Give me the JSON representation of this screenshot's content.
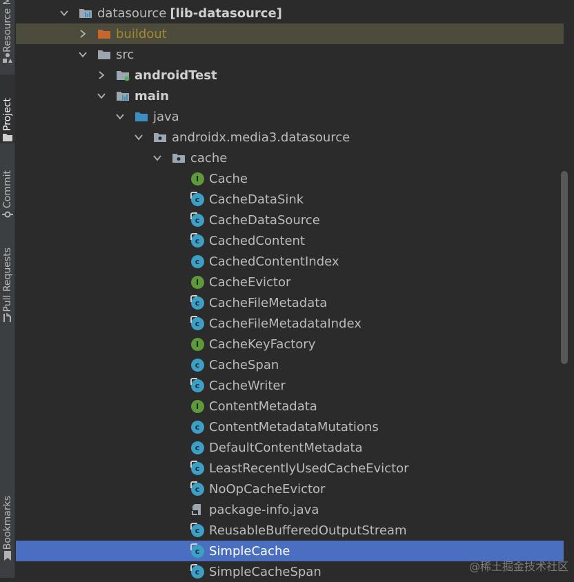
{
  "toolwindows": [
    {
      "label": "Resource Manager",
      "icon": "shapes-icon"
    },
    {
      "label": "Project",
      "icon": "folder-icon",
      "active": true
    },
    {
      "label": "Commit",
      "icon": "commit-icon"
    },
    {
      "label": "Pull Requests",
      "icon": "pull-request-icon"
    },
    {
      "label": "Bookmarks",
      "icon": "bookmark-icon"
    }
  ],
  "tree": [
    {
      "label": "datasource",
      "qualifier": "[lib-datasource]",
      "depth": 0,
      "arrow": "down",
      "icon": "module-folder-icon"
    },
    {
      "label": "buildout",
      "depth": 1,
      "arrow": "right",
      "icon": "excluded-folder-icon",
      "style": "orange",
      "highlight": true
    },
    {
      "label": "src",
      "depth": 1,
      "arrow": "down",
      "icon": "folder-icon"
    },
    {
      "label": "androidTest",
      "depth": 2,
      "arrow": "right",
      "icon": "test-folder-icon",
      "bold": true
    },
    {
      "label": "main",
      "depth": 2,
      "arrow": "down",
      "icon": "module-folder-icon",
      "bold": true
    },
    {
      "label": "java",
      "depth": 3,
      "arrow": "down",
      "icon": "source-folder-icon"
    },
    {
      "label": "androidx.media3.datasource",
      "depth": 4,
      "arrow": "down",
      "icon": "package-icon"
    },
    {
      "label": "cache",
      "depth": 5,
      "arrow": "down",
      "icon": "package-icon"
    },
    {
      "label": "Cache",
      "depth": 6,
      "icon": "interface-icon"
    },
    {
      "label": "CacheDataSink",
      "depth": 6,
      "icon": "class-icon",
      "pinned": true
    },
    {
      "label": "CacheDataSource",
      "depth": 6,
      "icon": "class-icon",
      "pinned": true
    },
    {
      "label": "CachedContent",
      "depth": 6,
      "icon": "class-icon",
      "pinned": true
    },
    {
      "label": "CachedContentIndex",
      "depth": 6,
      "icon": "class-icon"
    },
    {
      "label": "CacheEvictor",
      "depth": 6,
      "icon": "interface-icon"
    },
    {
      "label": "CacheFileMetadata",
      "depth": 6,
      "icon": "class-icon",
      "pinned": true
    },
    {
      "label": "CacheFileMetadataIndex",
      "depth": 6,
      "icon": "class-icon",
      "pinned": true
    },
    {
      "label": "CacheKeyFactory",
      "depth": 6,
      "icon": "interface-icon"
    },
    {
      "label": "CacheSpan",
      "depth": 6,
      "icon": "class-icon"
    },
    {
      "label": "CacheWriter",
      "depth": 6,
      "icon": "class-icon",
      "pinned": true
    },
    {
      "label": "ContentMetadata",
      "depth": 6,
      "icon": "interface-icon"
    },
    {
      "label": "ContentMetadataMutations",
      "depth": 6,
      "icon": "class-icon"
    },
    {
      "label": "DefaultContentMetadata",
      "depth": 6,
      "icon": "class-icon"
    },
    {
      "label": "LeastRecentlyUsedCacheEvictor",
      "depth": 6,
      "icon": "class-icon",
      "pinned": true
    },
    {
      "label": "NoOpCacheEvictor",
      "depth": 6,
      "icon": "class-icon",
      "pinned": true
    },
    {
      "label": "package-info.java",
      "depth": 6,
      "icon": "java-file-icon"
    },
    {
      "label": "ReusableBufferedOutputStream",
      "depth": 6,
      "icon": "class-icon",
      "pinned": true
    },
    {
      "label": "SimpleCache",
      "depth": 6,
      "icon": "class-icon",
      "pinned": true,
      "selected": true
    },
    {
      "label": "SimpleCacheSpan",
      "depth": 6,
      "icon": "class-icon",
      "pinned": true
    }
  ],
  "watermark": "@稀土掘金技术社区",
  "colors": {
    "background": "#2b2b2b",
    "selection": "#4a6fc1",
    "excluded_highlight": "#4c4b3c",
    "class_badge": "#3d9fc6",
    "interface_badge": "#5e9a3c",
    "excluded_folder": "#c8662f",
    "source_folder": "#3d8fc2"
  }
}
